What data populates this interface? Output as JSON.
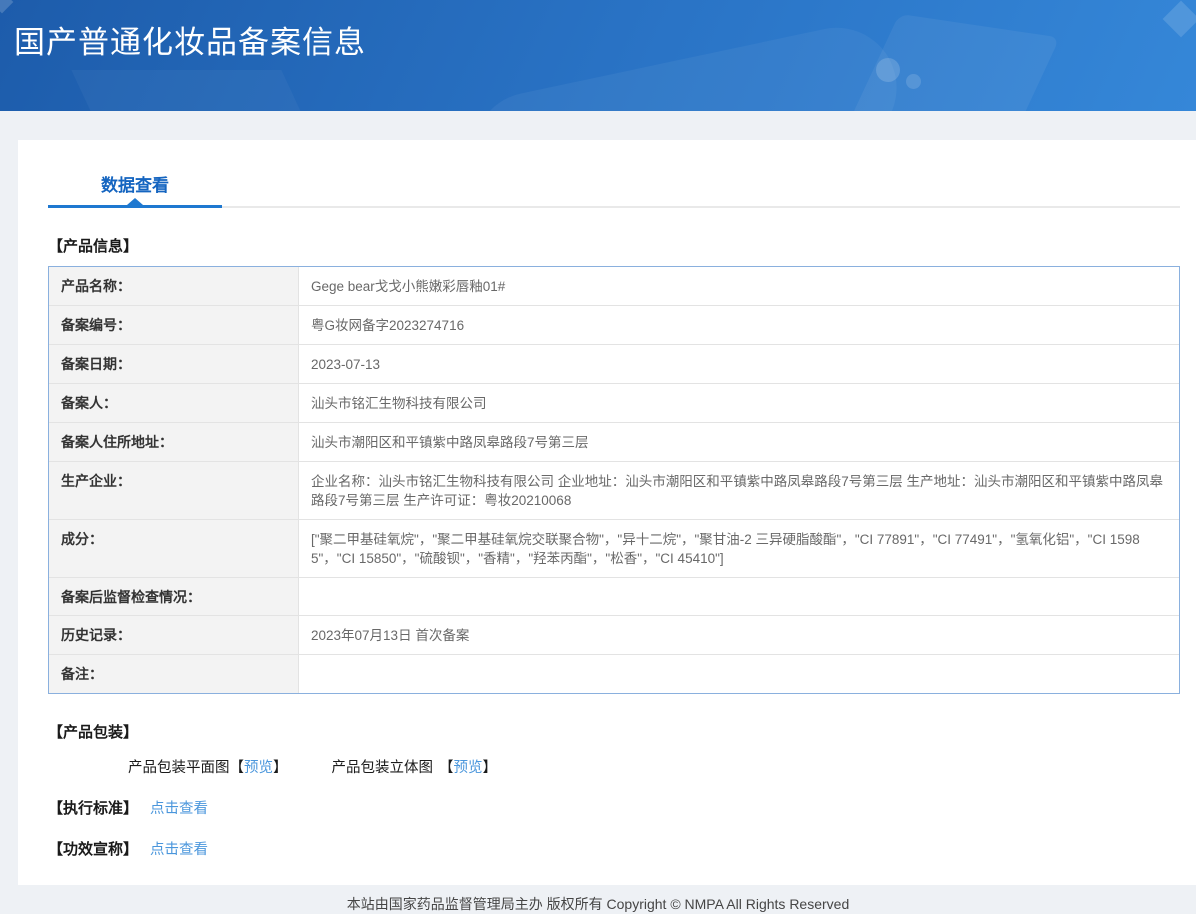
{
  "header": {
    "title": "国产普通化妆品备案信息"
  },
  "tab": {
    "label": "数据查看"
  },
  "product_info": {
    "section_title": "【产品信息】",
    "rows": [
      {
        "label": "产品名称：",
        "value": "Gege bear戈戈小熊嫩彩唇釉01#"
      },
      {
        "label": "备案编号：",
        "value": "粤G妆网备字2023274716"
      },
      {
        "label": "备案日期：",
        "value": "2023-07-13"
      },
      {
        "label": "备案人：",
        "value": "汕头市铭汇生物科技有限公司"
      },
      {
        "label": "备案人住所地址：",
        "value": "汕头市潮阳区和平镇紫中路凤皋路段7号第三层"
      },
      {
        "label": "生产企业：",
        "value": "企业名称：汕头市铭汇生物科技有限公司 企业地址：汕头市潮阳区和平镇紫中路凤皋路段7号第三层 生产地址：汕头市潮阳区和平镇紫中路凤皋路段7号第三层 生产许可证：粤妆20210068"
      },
      {
        "label": "成分：",
        "value": "[\"聚二甲基硅氧烷\"，\"聚二甲基硅氧烷交联聚合物\"，\"异十二烷\"，\"聚甘油-2 三异硬脂酸酯\"，\"CI 77891\"，\"CI 77491\"，\"氢氧化铝\"，\"CI 15985\"，\"CI 15850\"，\"硫酸钡\"，\"香精\"，\"羟苯丙酯\"，\"松香\"，\"CI 45410\"]"
      },
      {
        "label": "备案后监督检查情况：",
        "value": ""
      },
      {
        "label": "历史记录：",
        "value": "2023年07月13日 首次备案"
      },
      {
        "label": "备注：",
        "value": ""
      }
    ]
  },
  "packaging": {
    "section_title": "【产品包装】",
    "items": [
      {
        "label": "产品包装平面图",
        "bracket_open": "【",
        "link": "预览",
        "bracket_close": "】"
      },
      {
        "label": "产品包装立体图",
        "bracket_open": "【",
        "link": "预览",
        "bracket_close": "】"
      }
    ]
  },
  "standards": {
    "title": "【执行标准】",
    "link": "点击查看"
  },
  "efficacy": {
    "title": "【功效宣称】",
    "link": "点击查看"
  },
  "footer": {
    "text": "本站由国家药品监督管理局主办 版权所有 Copyright © NMPA All Rights Reserved"
  },
  "colors": {
    "header_gradient_start": "#1d5cab",
    "header_gradient_end": "#3587d8",
    "tab_active": "#1565c0",
    "tab_underline": "#1e78d0",
    "link": "#4a96dc",
    "table_border": "#8ab0de",
    "label_cell_bg": "#f3f3f3",
    "page_bg": "#eef1f5"
  }
}
